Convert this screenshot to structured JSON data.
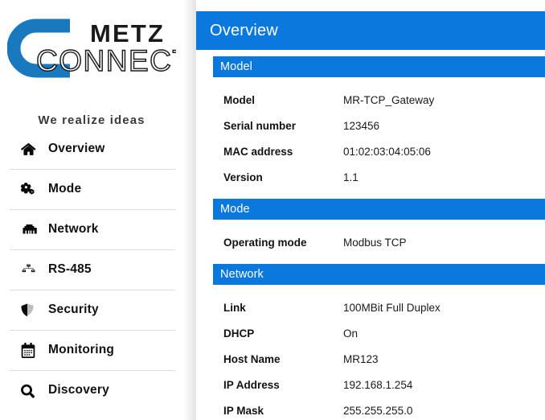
{
  "brand": {
    "name_top": "METZ",
    "name_bottom": "CONNECT",
    "tagline": "We realize ideas",
    "logo_color": "#1879bf"
  },
  "colors": {
    "accent_blue": "#0a78dc",
    "text": "#121212",
    "divider": "#dcdcdc"
  },
  "sidebar": {
    "items": [
      {
        "label": "Overview",
        "icon": "home-icon"
      },
      {
        "label": "Mode",
        "icon": "cogs-icon"
      },
      {
        "label": "Network",
        "icon": "ethernet-icon"
      },
      {
        "label": "RS-485",
        "icon": "sitemap-icon"
      },
      {
        "label": "Security",
        "icon": "shield-icon"
      },
      {
        "label": "Monitoring",
        "icon": "calendar-icon"
      },
      {
        "label": "Discovery",
        "icon": "search-icon"
      }
    ]
  },
  "page": {
    "title": "Overview",
    "sections": [
      {
        "title": "Model",
        "rows": [
          {
            "label": "Model",
            "value": "MR-TCP_Gateway"
          },
          {
            "label": "Serial number",
            "value": "123456"
          },
          {
            "label": "MAC address",
            "value": "01:02:03:04:05:06"
          },
          {
            "label": "Version",
            "value": "1.1"
          }
        ]
      },
      {
        "title": "Mode",
        "rows": [
          {
            "label": "Operating mode",
            "value": "Modbus TCP"
          }
        ]
      },
      {
        "title": "Network",
        "rows": [
          {
            "label": "Link",
            "value": "100MBit Full Duplex"
          },
          {
            "label": "DHCP",
            "value": "On"
          },
          {
            "label": "Host Name",
            "value": "MR123"
          },
          {
            "label": "IP Address",
            "value": "192.168.1.254"
          },
          {
            "label": "IP Mask",
            "value": "255.255.255.0"
          }
        ]
      }
    ]
  }
}
